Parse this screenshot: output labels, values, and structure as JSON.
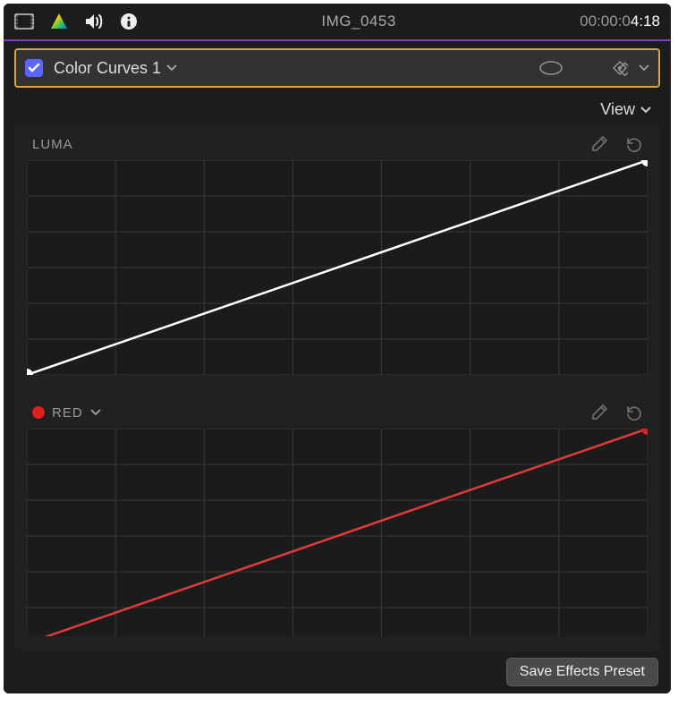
{
  "topbar": {
    "clip_name": "IMG_0453",
    "timecode_dim": "00:00:0",
    "timecode_bright": "4:18"
  },
  "effect_row": {
    "name": "Color Curves 1",
    "enabled": true
  },
  "view": {
    "label": "View"
  },
  "curves": {
    "luma": {
      "label": "LUMA",
      "line_color": "#ffffff",
      "point_color": "#ffffff"
    },
    "red": {
      "label": "RED",
      "swatch_color": "#e11d1d",
      "line_color": "#e13a3a",
      "point_color": "#e11d1d"
    }
  },
  "chart_data": [
    {
      "type": "line",
      "title": "LUMA",
      "x": [
        0,
        1
      ],
      "values": [
        0,
        1
      ],
      "xlim": [
        0,
        1
      ],
      "ylim": [
        0,
        1
      ],
      "xlabel": "",
      "ylabel": ""
    },
    {
      "type": "line",
      "title": "RED",
      "x": [
        0,
        1
      ],
      "values": [
        0,
        1
      ],
      "xlim": [
        0,
        1
      ],
      "ylim": [
        0,
        1
      ],
      "xlabel": "",
      "ylabel": ""
    }
  ],
  "footer": {
    "save_preset": "Save Effects Preset"
  }
}
